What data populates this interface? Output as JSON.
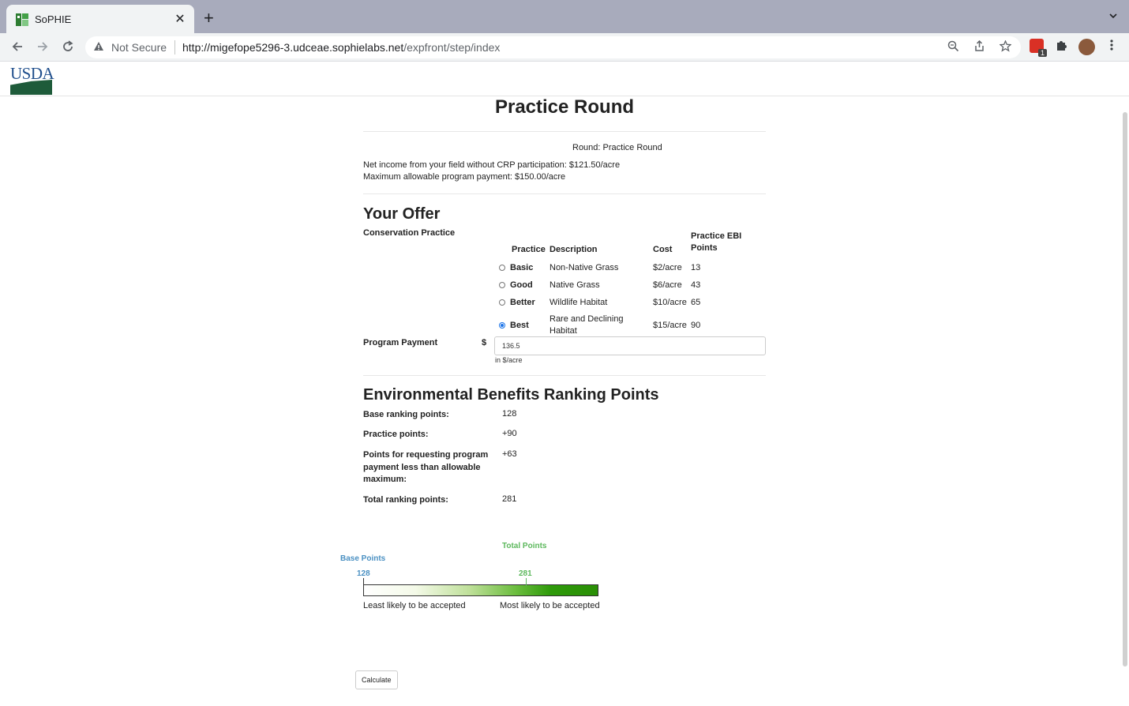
{
  "browser": {
    "tab_title": "SoPHIE",
    "tab_close": "✕",
    "new_tab": "+",
    "security_label": "Not Secure",
    "url_host": "http://migefope5296-3.udceae.sophielabs.net",
    "url_path": "/expfront/step/index",
    "extension_badge": "1"
  },
  "header": {
    "logo_text": "USDA"
  },
  "page": {
    "title": "Practice Round",
    "round_label": "Round: Practice Round",
    "net_income": "Net income from your field without CRP participation: $121.50/acre",
    "max_payment": "Maximum allowable program payment: $150.00/acre"
  },
  "offer": {
    "heading": "Your Offer",
    "conservation_label": "Conservation Practice",
    "columns": [
      "Practice",
      "Description",
      "Cost",
      "Practice EBI Points"
    ],
    "practices": [
      {
        "name": "Basic",
        "description": "Non-Native Grass",
        "cost": "$2/acre",
        "points": "13",
        "selected": false
      },
      {
        "name": "Good",
        "description": "Native Grass",
        "cost": "$6/acre",
        "points": "43",
        "selected": false
      },
      {
        "name": "Better",
        "description": "Wildlife Habitat",
        "cost": "$10/acre",
        "points": "65",
        "selected": false
      },
      {
        "name": "Best",
        "description": "Rare and Declining Habitat",
        "cost": "$15/acre",
        "points": "90",
        "selected": true
      }
    ],
    "payment_label": "Program Payment",
    "currency": "$",
    "payment_value": "136.5",
    "payment_help": "in $/acre"
  },
  "ebr": {
    "heading": "Environmental Benefits Ranking Points",
    "base_label": "Base ranking points:",
    "base_value": "128",
    "practice_label": "Practice points:",
    "practice_value": "+90",
    "payment_points_label": "Points for requesting program payment less than allowable maximum:",
    "payment_points_value": "+63",
    "total_label": "Total ranking points:",
    "total_value": "281"
  },
  "gauge": {
    "total_title": "Total Points",
    "base_title": "Base Points",
    "base_value": "128",
    "total_value": "281",
    "low_label": "Least likely to be accepted",
    "high_label": "Most likely to be accepted",
    "colors": {
      "base": "#4a90c2",
      "total": "#5cb85c",
      "bar_end": "#2a8f06"
    }
  },
  "actions": {
    "calculate_label": "Calculate"
  }
}
